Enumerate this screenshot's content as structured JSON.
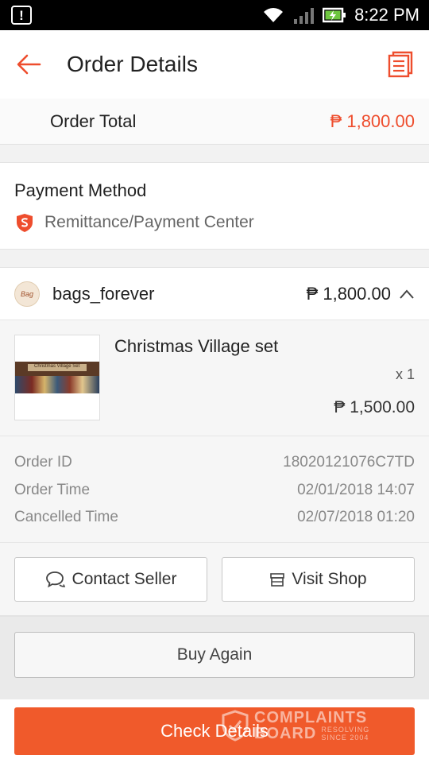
{
  "status_bar": {
    "time": "8:22 PM"
  },
  "header": {
    "title": "Order Details"
  },
  "order_total": {
    "label": "Order Total",
    "value": "₱ 1,800.00"
  },
  "payment": {
    "title": "Payment Method",
    "method": "Remittance/Payment Center"
  },
  "shop": {
    "name": "bags_forever",
    "total": "₱ 1,800.00",
    "avatar_text": "Bag",
    "product": {
      "name": "Christmas Village set",
      "quantity": "x 1",
      "price": "₱ 1,500.00",
      "thumb_label": "Christmas Village Set"
    }
  },
  "meta": [
    {
      "label": "Order ID",
      "value": "18020121076C7TD"
    },
    {
      "label": "Order Time",
      "value": "02/01/2018 14:07"
    },
    {
      "label": "Cancelled Time",
      "value": "02/07/2018 01:20"
    }
  ],
  "actions": {
    "contact_seller": "Contact Seller",
    "visit_shop": "Visit Shop"
  },
  "buy_again": "Buy Again",
  "primary_button": "Check Details",
  "watermark": {
    "line1": "COMPLAINTS",
    "line2": "BOARD",
    "line3": "RESOLVING",
    "line4": "SINCE 2004"
  },
  "colors": {
    "accent": "#ee4d2d",
    "primary_button": "#f05a2b"
  },
  "icons": [
    "notification-icon",
    "wifi-icon",
    "cell-signal-icon",
    "battery-charging-icon",
    "back-arrow-icon",
    "receipt-icon",
    "shield-s-icon",
    "chevron-up-icon",
    "chat-icon",
    "shop-icon"
  ]
}
